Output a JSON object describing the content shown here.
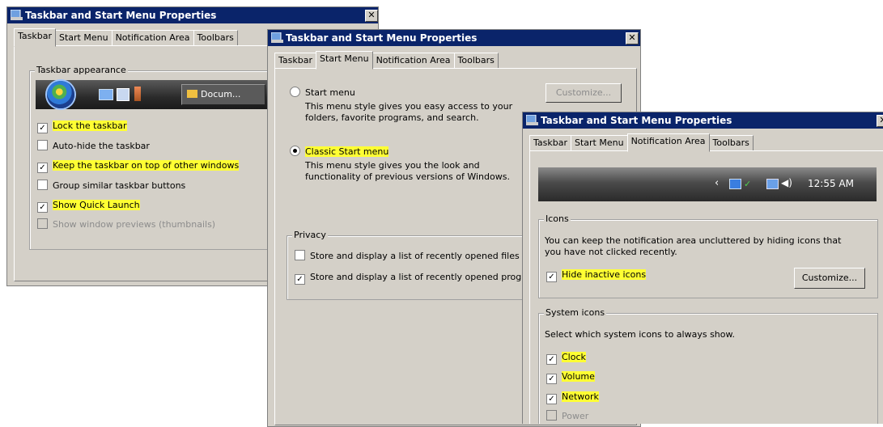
{
  "windows": [
    {
      "title": "Taskbar and Start Menu Properties",
      "tabs": [
        "Taskbar",
        "Start Menu",
        "Notification Area",
        "Toolbars"
      ],
      "group_label": "Taskbar appearance",
      "preview_button": "Docum...",
      "options": [
        {
          "label": "Lock the taskbar",
          "checked": true
        },
        {
          "label": "Auto-hide the taskbar",
          "checked": false
        },
        {
          "label": "Keep the taskbar on top of other windows",
          "checked": true
        },
        {
          "label": "Group similar taskbar buttons",
          "checked": false
        },
        {
          "label": "Show Quick Launch",
          "checked": true
        },
        {
          "label": "Show window previews (thumbnails)",
          "checked": false,
          "disabled": true
        }
      ]
    },
    {
      "title": "Taskbar and Start Menu Properties",
      "tabs": [
        "Taskbar",
        "Start Menu",
        "Notification Area",
        "Toolbars"
      ],
      "start_menu_label": "Start menu",
      "start_menu_desc": [
        "This menu style gives you easy access to your",
        "folders, favorite programs, and search."
      ],
      "customize_label": "Customize...",
      "classic_label": "Classic Start menu",
      "classic_desc": [
        "This menu style gives you the look and",
        "functionality of previous versions of Windows."
      ],
      "privacy_label": "Privacy",
      "privacy_options": [
        {
          "label": "Store and display a list of recently opened files",
          "checked": false
        },
        {
          "label": "Store and display a list of recently opened programs",
          "checked": true
        }
      ]
    },
    {
      "title": "Taskbar and Start Menu Properties",
      "tabs": [
        "Taskbar",
        "Start Menu",
        "Notification Area",
        "Toolbars"
      ],
      "clock": "12:55 AM",
      "icons_label": "Icons",
      "icons_desc": [
        "You can keep the notification area uncluttered by hiding icons that",
        "you have not clicked recently."
      ],
      "hide_inactive": "Hide inactive icons",
      "customize_label": "Customize...",
      "system_icons_label": "System icons",
      "system_icons_desc": "Select which system icons to always show.",
      "system_icons": [
        {
          "label": "Clock",
          "checked": true
        },
        {
          "label": "Volume",
          "checked": true
        },
        {
          "label": "Network",
          "checked": true
        },
        {
          "label": "Power",
          "checked": false,
          "disabled": true
        }
      ]
    }
  ],
  "colors": {
    "highlight": "#ffff33",
    "titlebar": "#0a246a",
    "dialog": "#d4d0c8"
  }
}
